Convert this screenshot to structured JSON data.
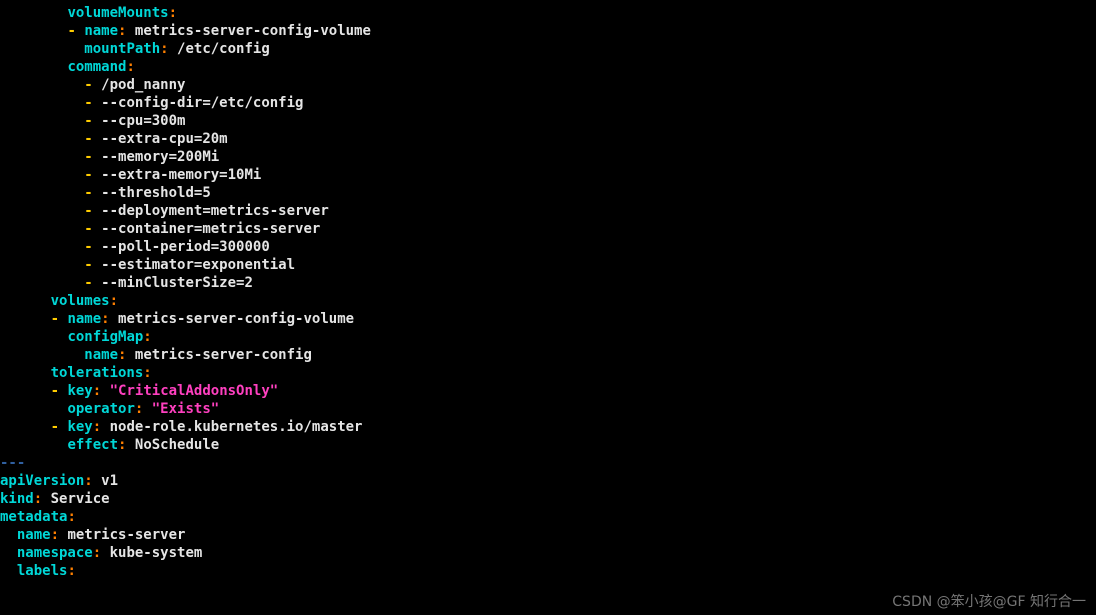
{
  "yaml": {
    "volumeMounts": [
      {
        "name": "metrics-server-config-volume",
        "mountPath": "/etc/config"
      }
    ],
    "command": [
      "/pod_nanny",
      "--config-dir=/etc/config",
      "--cpu=300m",
      "--extra-cpu=20m",
      "--memory=200Mi",
      "--extra-memory=10Mi",
      "--threshold=5",
      "--deployment=metrics-server",
      "--container=metrics-server",
      "--poll-period=300000",
      "--estimator=exponential",
      "--minClusterSize=2"
    ],
    "volumes": [
      {
        "name": "metrics-server-config-volume",
        "configMap": {
          "name": "metrics-server-config"
        }
      }
    ],
    "tolerations": [
      {
        "key": "\"CriticalAddonsOnly\"",
        "operator": "\"Exists\""
      },
      {
        "key": "node-role.kubernetes.io/master",
        "effect": "NoSchedule"
      }
    ],
    "docSep": "---",
    "apiVersion": "v1",
    "kind": "Service",
    "metadataKey": "metadata",
    "metadata": {
      "name": "metrics-server",
      "namespace": "kube-system"
    },
    "labelsKey": "labels"
  },
  "watermark": "CSDN @笨小孩@GF 知行合一"
}
